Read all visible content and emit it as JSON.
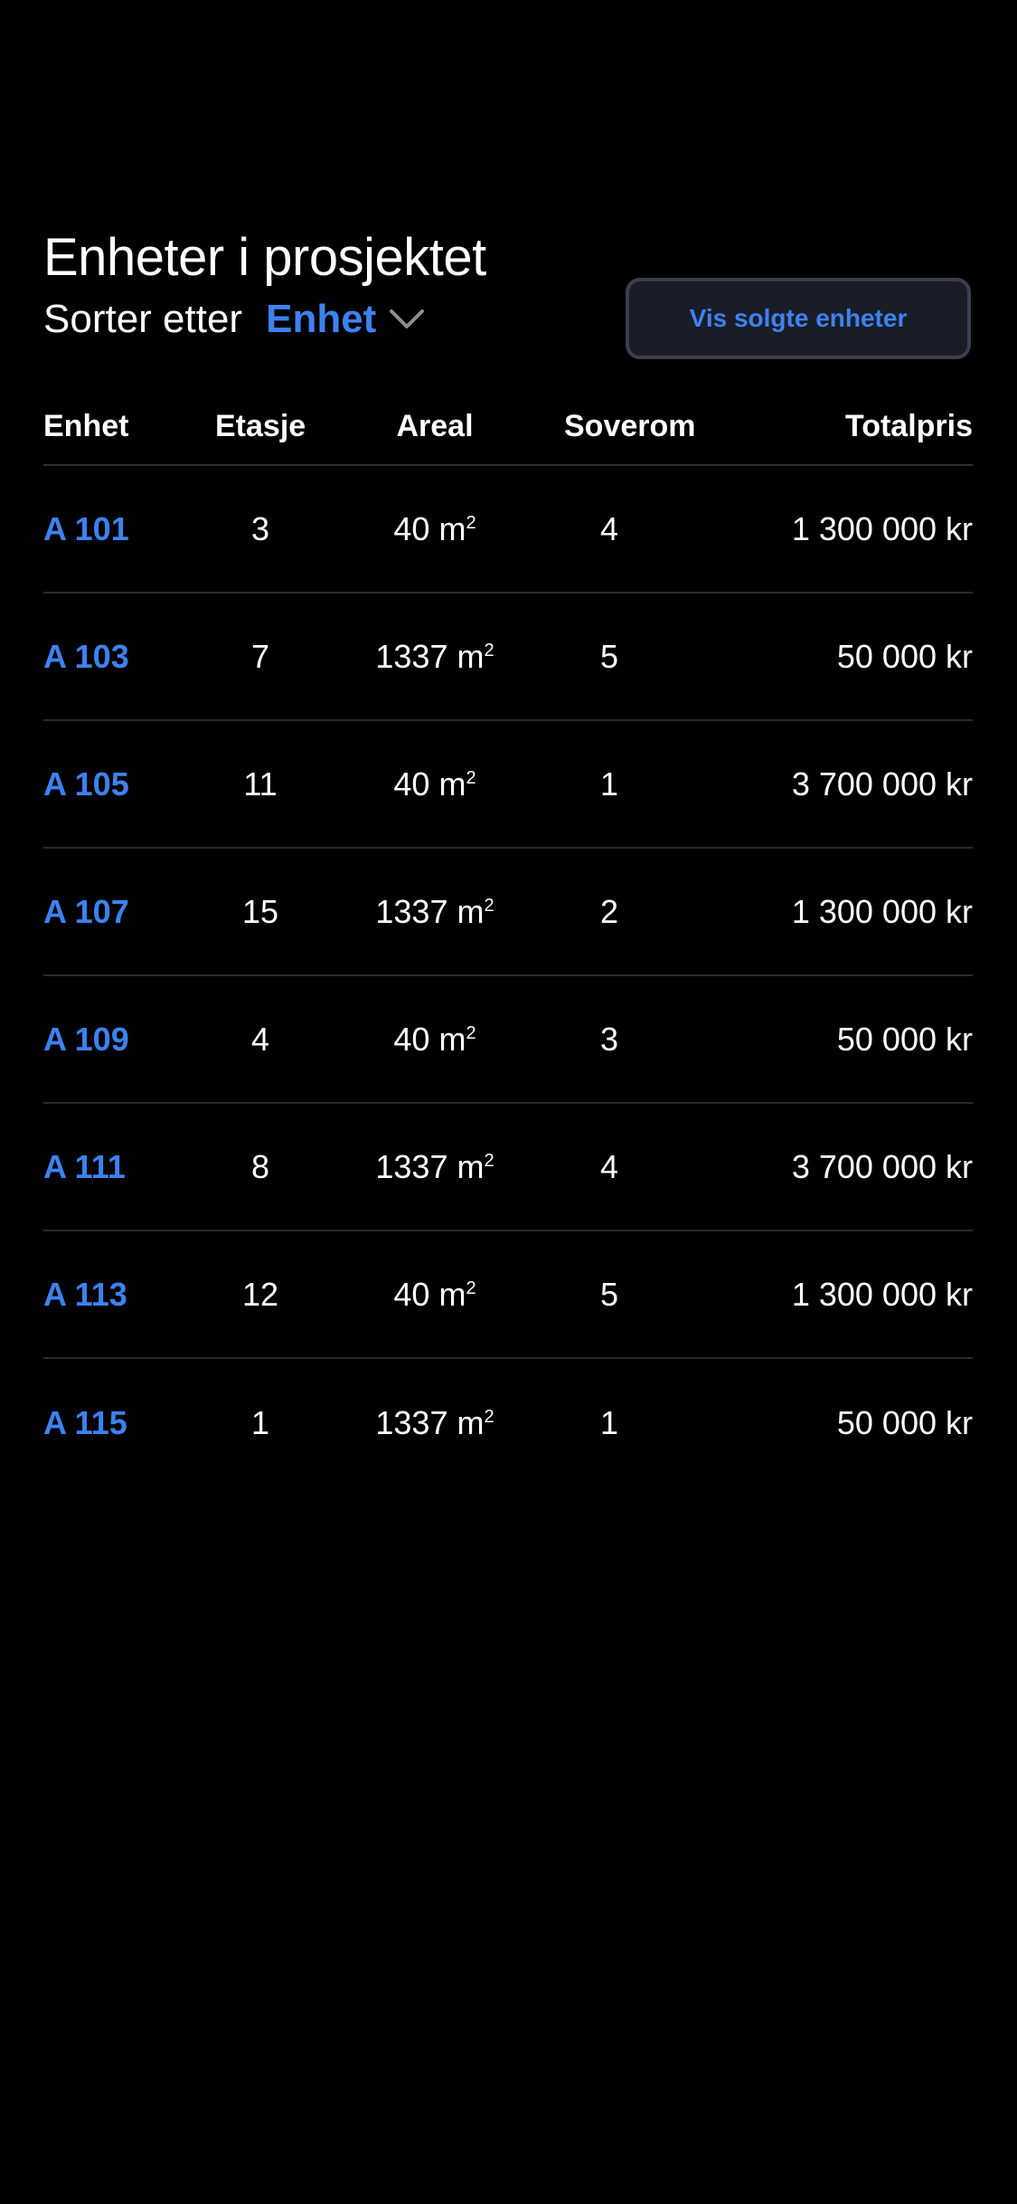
{
  "page": {
    "title": "Enheter i prosjektet"
  },
  "sort": {
    "label": "Sorter etter",
    "value": "Enhet",
    "icon": "chevron-down-icon"
  },
  "sold_button": {
    "label": "Vis solgte enheter"
  },
  "table": {
    "headers": {
      "unit": "Enhet",
      "floor": "Etasje",
      "area": "Areal",
      "bedrooms": "Soverom",
      "price": "Totalpris"
    },
    "area_unit": "m",
    "area_unit_exp": "2",
    "rows": [
      {
        "unit": "A 101",
        "floor": "3",
        "area": "40",
        "bedrooms": "4",
        "price": "1 300 000 kr"
      },
      {
        "unit": "A 103",
        "floor": "7",
        "area": "1337",
        "bedrooms": "5",
        "price": "50 000 kr"
      },
      {
        "unit": "A 105",
        "floor": "11",
        "area": "40",
        "bedrooms": "1",
        "price": "3 700 000 kr"
      },
      {
        "unit": "A 107",
        "floor": "15",
        "area": "1337",
        "bedrooms": "2",
        "price": "1 300 000 kr"
      },
      {
        "unit": "A 109",
        "floor": "4",
        "area": "40",
        "bedrooms": "3",
        "price": "50 000 kr"
      },
      {
        "unit": "A 111",
        "floor": "8",
        "area": "1337",
        "bedrooms": "4",
        "price": "3 700 000 kr"
      },
      {
        "unit": "A 113",
        "floor": "12",
        "area": "40",
        "bedrooms": "5",
        "price": "1 300 000 kr"
      },
      {
        "unit": "A 115",
        "floor": "1",
        "area": "1337",
        "bedrooms": "1",
        "price": "50 000 kr"
      }
    ]
  },
  "colors": {
    "background": "#000000",
    "accent": "#3d82f0",
    "text": "#ffffff",
    "button_bg": "#1a1c28",
    "button_border": "#3b3e4f",
    "divider": "#2a2a2e"
  }
}
